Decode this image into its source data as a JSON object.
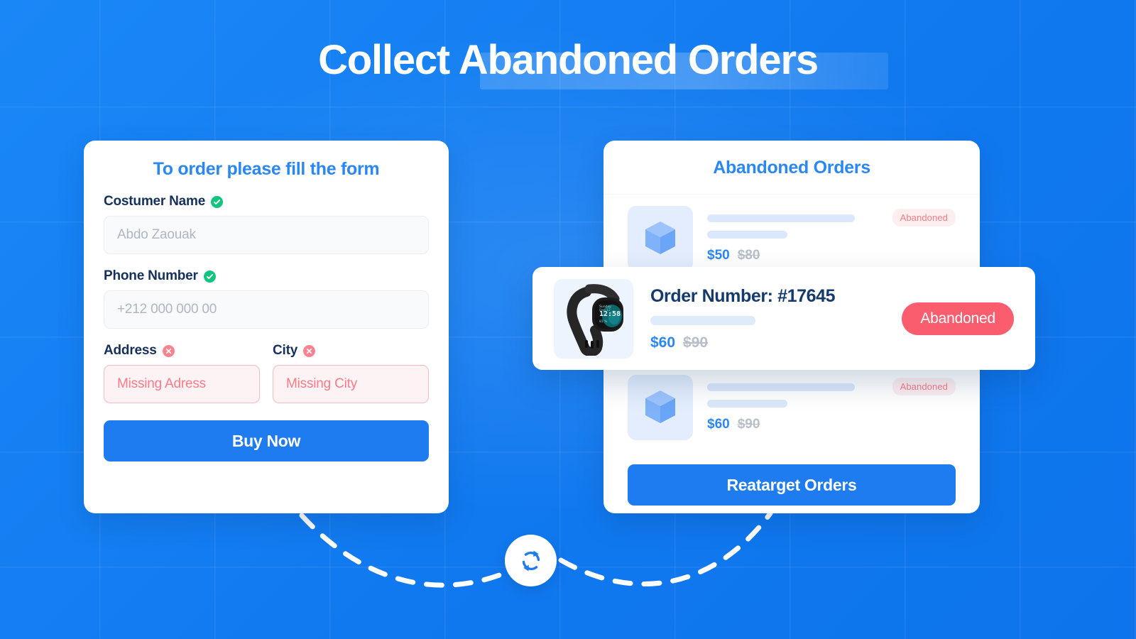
{
  "page": {
    "title": "Collect Abandoned Orders",
    "title_plain_part": "Collect ",
    "title_highlight_part": "Abandoned Orders"
  },
  "colors": {
    "background_blue": "#1179ef",
    "accent_blue": "#2b87f3",
    "button_blue": "#1f7cf0",
    "navy_text": "#153a6e",
    "success_green": "#12c47e",
    "error_red": "#fa5d6e",
    "error_soft_pink": "#fdeef0"
  },
  "form_card": {
    "title": "To order please fill the form",
    "fields": [
      {
        "label": "Costumer Name",
        "status": "valid",
        "status_icon": "check-circle-icon",
        "placeholder": "Abdo Zaouak",
        "value": ""
      },
      {
        "label": "Phone Number",
        "status": "valid",
        "status_icon": "check-circle-icon",
        "placeholder": "+212 000 000 00",
        "value": ""
      },
      {
        "label": "Address",
        "status": "error",
        "status_icon": "x-circle-icon",
        "placeholder": "Missing Adress",
        "value": ""
      },
      {
        "label": "City",
        "status": "error",
        "status_icon": "x-circle-icon",
        "placeholder": "Missing City",
        "value": ""
      }
    ],
    "submit_label": "Buy Now"
  },
  "orders_card": {
    "title": "Abandoned Orders",
    "rows": [
      {
        "thumb_icon": "cube-icon",
        "price_new": "$50",
        "price_old": "$80",
        "status_label": "Abandoned"
      },
      {
        "thumb_icon": "cube-icon",
        "price_new": "$60",
        "price_old": "$90",
        "status_label": "Abandoned"
      }
    ],
    "retarget_label": "Reatarget Orders"
  },
  "featured_order": {
    "thumb_icon": "smartwatch-image",
    "order_number": "Order Number: #17645",
    "price_new": "$60",
    "price_old": "$90",
    "status_label": "Abandoned"
  },
  "connector": {
    "sync_icon": "sync-refresh-icon"
  }
}
